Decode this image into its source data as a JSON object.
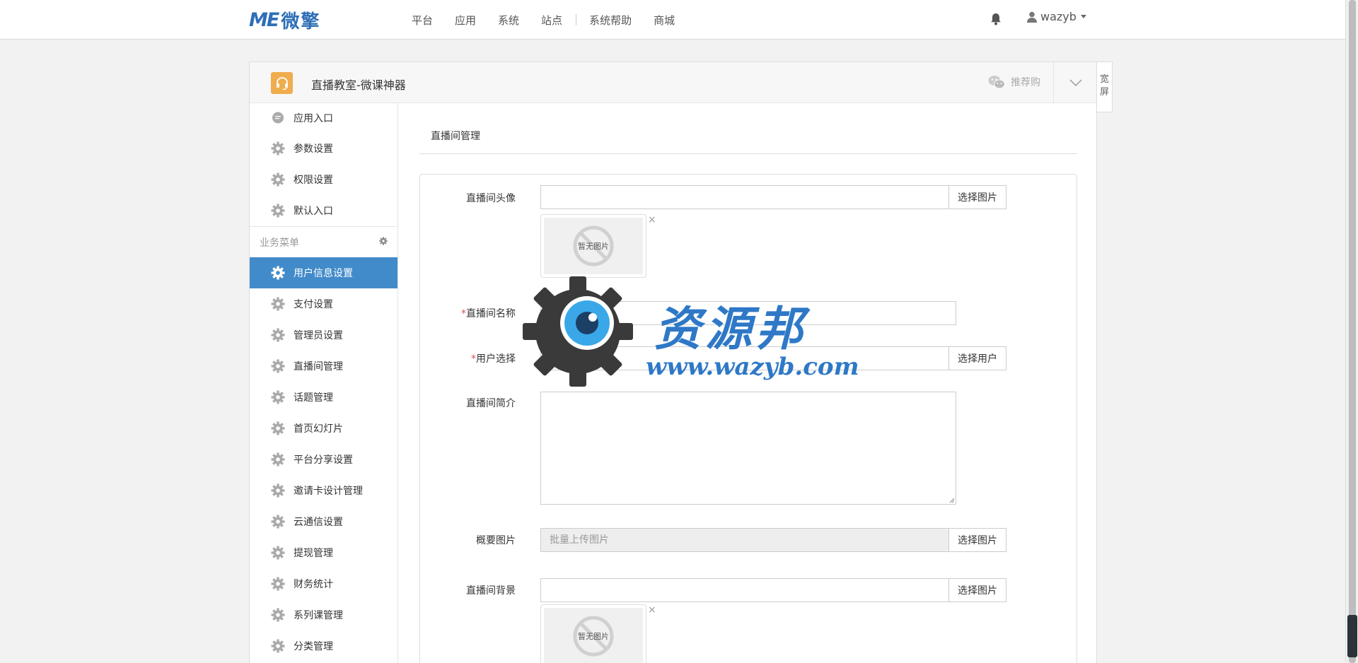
{
  "topbar": {
    "logo_mark": "ME",
    "logo_text": "微擎",
    "nav": [
      "平台",
      "应用",
      "系统",
      "站点",
      "系统帮助",
      "商城"
    ],
    "username": "wazyb"
  },
  "panel": {
    "app_title": "直播教室-微课神器",
    "recommend_label": "推荐购",
    "wide_label_1": "宽",
    "wide_label_2": "屏"
  },
  "sidebar": {
    "top_items": [
      {
        "label": "应用入口",
        "icon": "chat-bubble-icon"
      },
      {
        "label": "参数设置",
        "icon": "gear-icon"
      },
      {
        "label": "权限设置",
        "icon": "gear-icon"
      },
      {
        "label": "默认入口",
        "icon": "gear-icon"
      }
    ],
    "group_title": "业务菜单",
    "business_items": [
      {
        "label": "用户信息设置",
        "active": true
      },
      {
        "label": "支付设置"
      },
      {
        "label": "管理员设置"
      },
      {
        "label": "直播间管理"
      },
      {
        "label": "话题管理"
      },
      {
        "label": "首页幻灯片"
      },
      {
        "label": "平台分享设置"
      },
      {
        "label": "邀请卡设计管理"
      },
      {
        "label": "云通信设置"
      },
      {
        "label": "提现管理"
      },
      {
        "label": "财务统计"
      },
      {
        "label": "系列课管理"
      },
      {
        "label": "分类管理"
      }
    ]
  },
  "content": {
    "tab_label": "直播间管理",
    "form": {
      "avatar_label": "直播间头像",
      "select_image": "选择图片",
      "no_image": "暂无图片",
      "close": "×",
      "name_label": "直播间名称",
      "required_mark": "*",
      "user_label": "用户选择",
      "select_user": "选择用户",
      "intro_label": "直播间简介",
      "summary_label": "概要图片",
      "summary_placeholder": "批量上传图片",
      "bg_label": "直播间背景"
    }
  },
  "watermark": {
    "title": "资源邦",
    "url": "www.wazyb.com"
  },
  "colors": {
    "accent": "#428bca",
    "brand": "#2e6fb7",
    "app_icon": "#f0ad4e",
    "required": "#d9534f"
  }
}
